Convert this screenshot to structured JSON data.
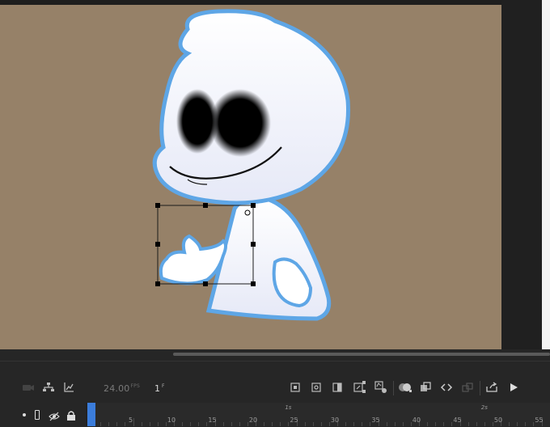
{
  "timeline": {
    "fps_value": "24.00",
    "fps_unit": "FPS",
    "frame_value": "1",
    "frame_unit": "F",
    "seconds_labels": [
      "1s",
      "2s"
    ],
    "frame_labels": [
      "5",
      "10",
      "15",
      "20",
      "25",
      "30",
      "35",
      "40",
      "45",
      "50",
      "55"
    ]
  },
  "stage": {
    "background_color": "#968168",
    "character_outline_color": "#5ea6e6",
    "selection_box": "ghost-hand-symbol"
  },
  "icons": {
    "camera": "camera-icon",
    "layer_parenting": "layer-parenting-icon",
    "graph": "graph-icon",
    "play": "play-icon"
  }
}
